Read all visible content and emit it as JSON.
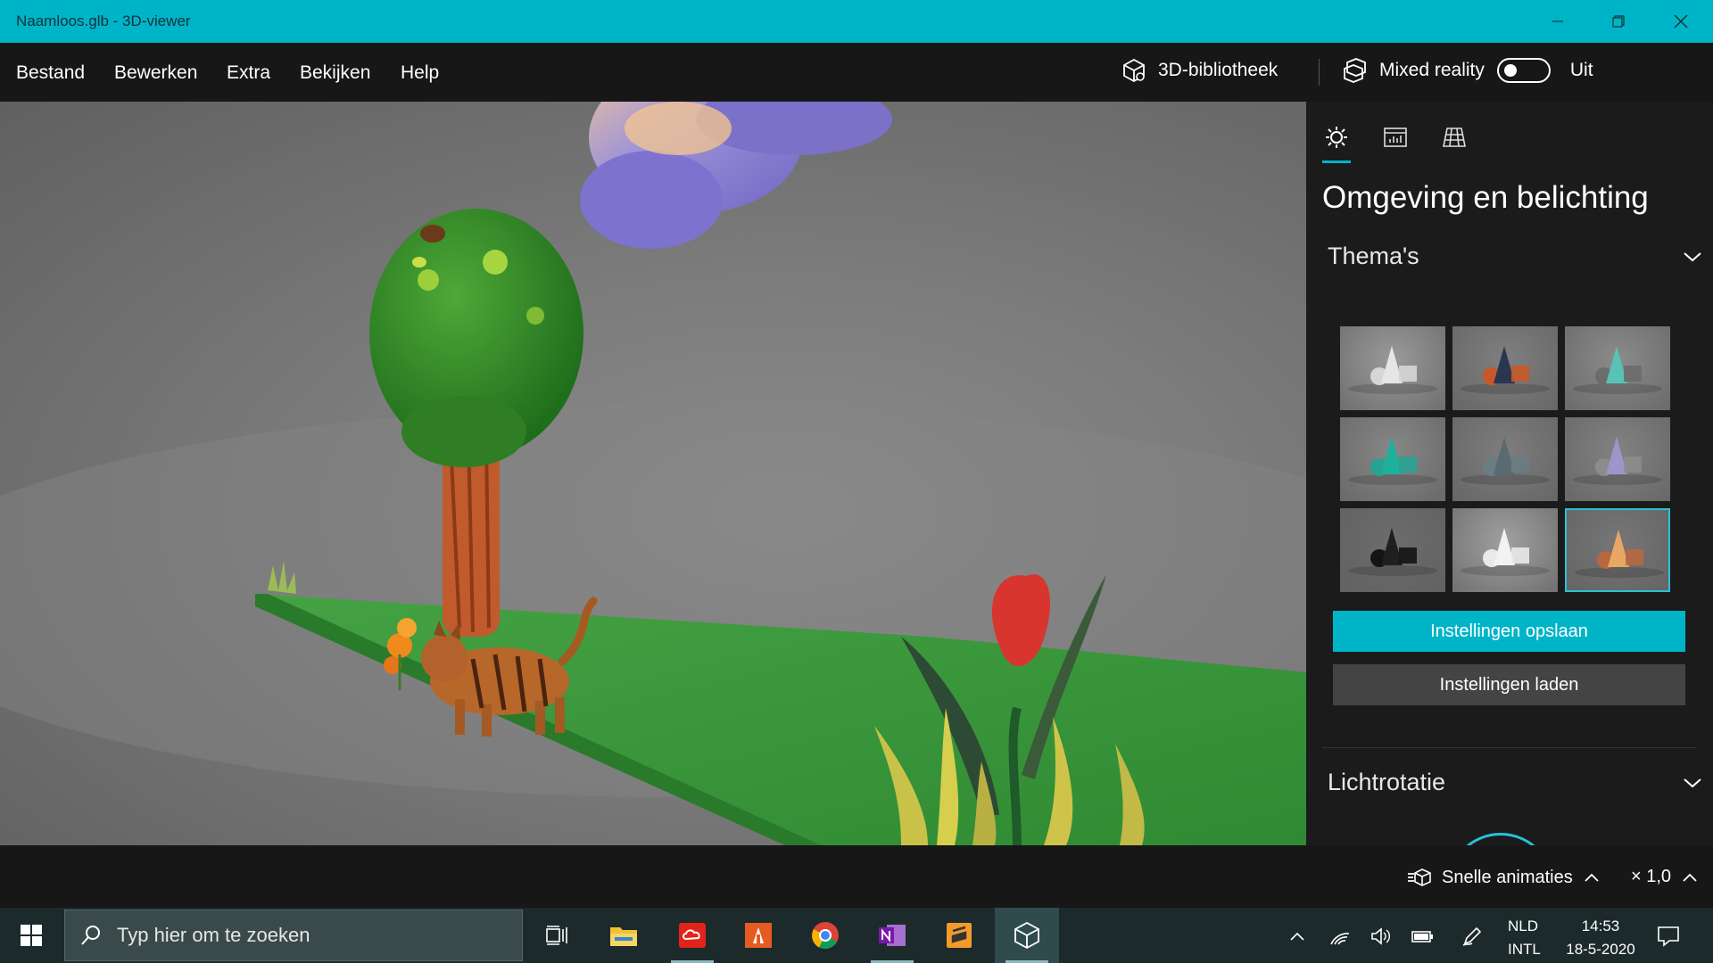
{
  "window": {
    "title": "Naamloos.glb - 3D-viewer",
    "accent": "#00B4C8"
  },
  "menu": {
    "items": [
      "Bestand",
      "Bewerken",
      "Extra",
      "Bekijken",
      "Help"
    ],
    "library_label": "3D-bibliotheek",
    "mixed_reality_label": "Mixed reality",
    "mixed_reality_state": "Uit"
  },
  "panel": {
    "tabs": [
      "sun-icon",
      "stats-icon",
      "grid-icon"
    ],
    "title": "Omgeving en belichting",
    "themes_header": "Thema's",
    "themes": [
      {
        "name": "theme-1",
        "bg": "#9a9a9a",
        "shape": "#e6e6e6",
        "accent": "#d6d6d6",
        "selected": false
      },
      {
        "name": "theme-2",
        "bg": "#7f7f7f",
        "shape": "#2b3550",
        "accent": "#c8582a",
        "selected": false
      },
      {
        "name": "theme-3",
        "bg": "#8b8b8b",
        "shape": "#57c2b5",
        "accent": "#6c6c6c",
        "selected": false
      },
      {
        "name": "theme-4",
        "bg": "#878787",
        "shape": "#1eb09a",
        "accent": "#27a393",
        "selected": false
      },
      {
        "name": "theme-5",
        "bg": "#7d7d7d",
        "shape": "#5a6a72",
        "accent": "#6a7d82",
        "selected": false
      },
      {
        "name": "theme-6",
        "bg": "#828282",
        "shape": "#9f95c8",
        "accent": "#8c8c8c",
        "selected": false
      },
      {
        "name": "theme-7",
        "bg": "#6c6c6c",
        "shape": "#1f1f1f",
        "accent": "#141414",
        "selected": false
      },
      {
        "name": "theme-8",
        "bg": "#a0a0a0",
        "shape": "#f2f2f2",
        "accent": "#e9e9e9",
        "selected": false
      },
      {
        "name": "theme-9",
        "bg": "#767676",
        "shape": "#e8a766",
        "accent": "#b8673f",
        "selected": true
      }
    ],
    "save_button": "Instellingen opslaan",
    "load_button": "Instellingen laden",
    "light_rotation_header": "Lichtrotatie"
  },
  "bottom": {
    "animations_label": "Snelle animaties",
    "speed_label": "× 1,0"
  },
  "taskbar": {
    "search_placeholder": "Typ hier om te zoeken",
    "apps": [
      {
        "name": "task-view-icon",
        "color": "#ffffff"
      },
      {
        "name": "file-explorer-icon",
        "color": "#f2c233"
      },
      {
        "name": "creative-cloud-icon",
        "color": "#e2231a"
      },
      {
        "name": "app-orange-icon",
        "color": "#e55b21"
      },
      {
        "name": "chrome-icon",
        "color": "#4285f4"
      },
      {
        "name": "onenote-icon",
        "color": "#7719aa"
      },
      {
        "name": "sublime-icon",
        "color": "#f39a2b"
      },
      {
        "name": "3d-viewer-icon",
        "color": "#ffffff"
      }
    ],
    "lang_line1": "NLD",
    "lang_line2": "INTL",
    "time": "14:53",
    "date": "18-5-2020"
  }
}
